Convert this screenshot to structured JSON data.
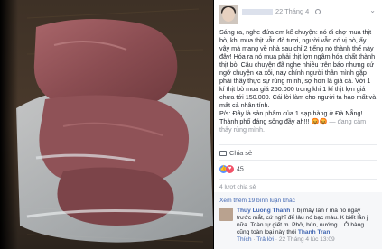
{
  "post": {
    "date_line": "22 Tháng 4 ·",
    "body": [
      "Sáng ra, nghe đứa em kể chuyện: nó đi chợ mua thịt bò, khi mua thịt vẫn đỏ tươi, người vẫn có vị bò, ấy vậy mà mang về nhà sau chỉ 2 tiếng nó thành thế này đây! Hóa ra nó mua phải thịt lợn ngâm hóa chất thành thịt bò. Câu chuyện đã nghe nhiều trên báo nhưng cứ ngỡ chuyện xa xôi, nay chính người thân mình gặp phải thấy thực sự rùng mình, sợ hơn là giá cả. Với 1 kí thịt bò mua giá 250.000 trong khi 1 kí thịt lợn giá chưa tới 150.000. Cái lời làm cho người ta hao mất và mất cả nhân tính.",
      "P/s: Đây là sản phẩm của 1 sạp hàng ở Đà Nẵng! Thành phố đáng sống đầy ah!!!"
    ],
    "emoji_link": "😡😡",
    "feeling": "— đang cảm thấy rùng mình.",
    "share_label": "Chia sẻ",
    "reaction_count": "45",
    "stats": {
      "shares": "4 lượt chia sẻ",
      "comments": "19 bình luận"
    }
  },
  "comments": {
    "more_link": "Xem thêm 19 bình luận khác",
    "items": [
      {
        "author": "Thuy Luong Thanh",
        "text": "T bị mấy lần r má nó ngay trước mắt, cứ nghĩ để lâu nó bạc màu. K biết lằn j nữa. Toàn tự giết m. Phở, bún, nướng... Ở hàng cũng toàn loại này thôi",
        "tag": "Thanh Tran",
        "meta_like": "Thích",
        "meta_reply": "Trả lời",
        "meta_time": "22 Tháng 4 lúc 13:09"
      }
    ]
  }
}
